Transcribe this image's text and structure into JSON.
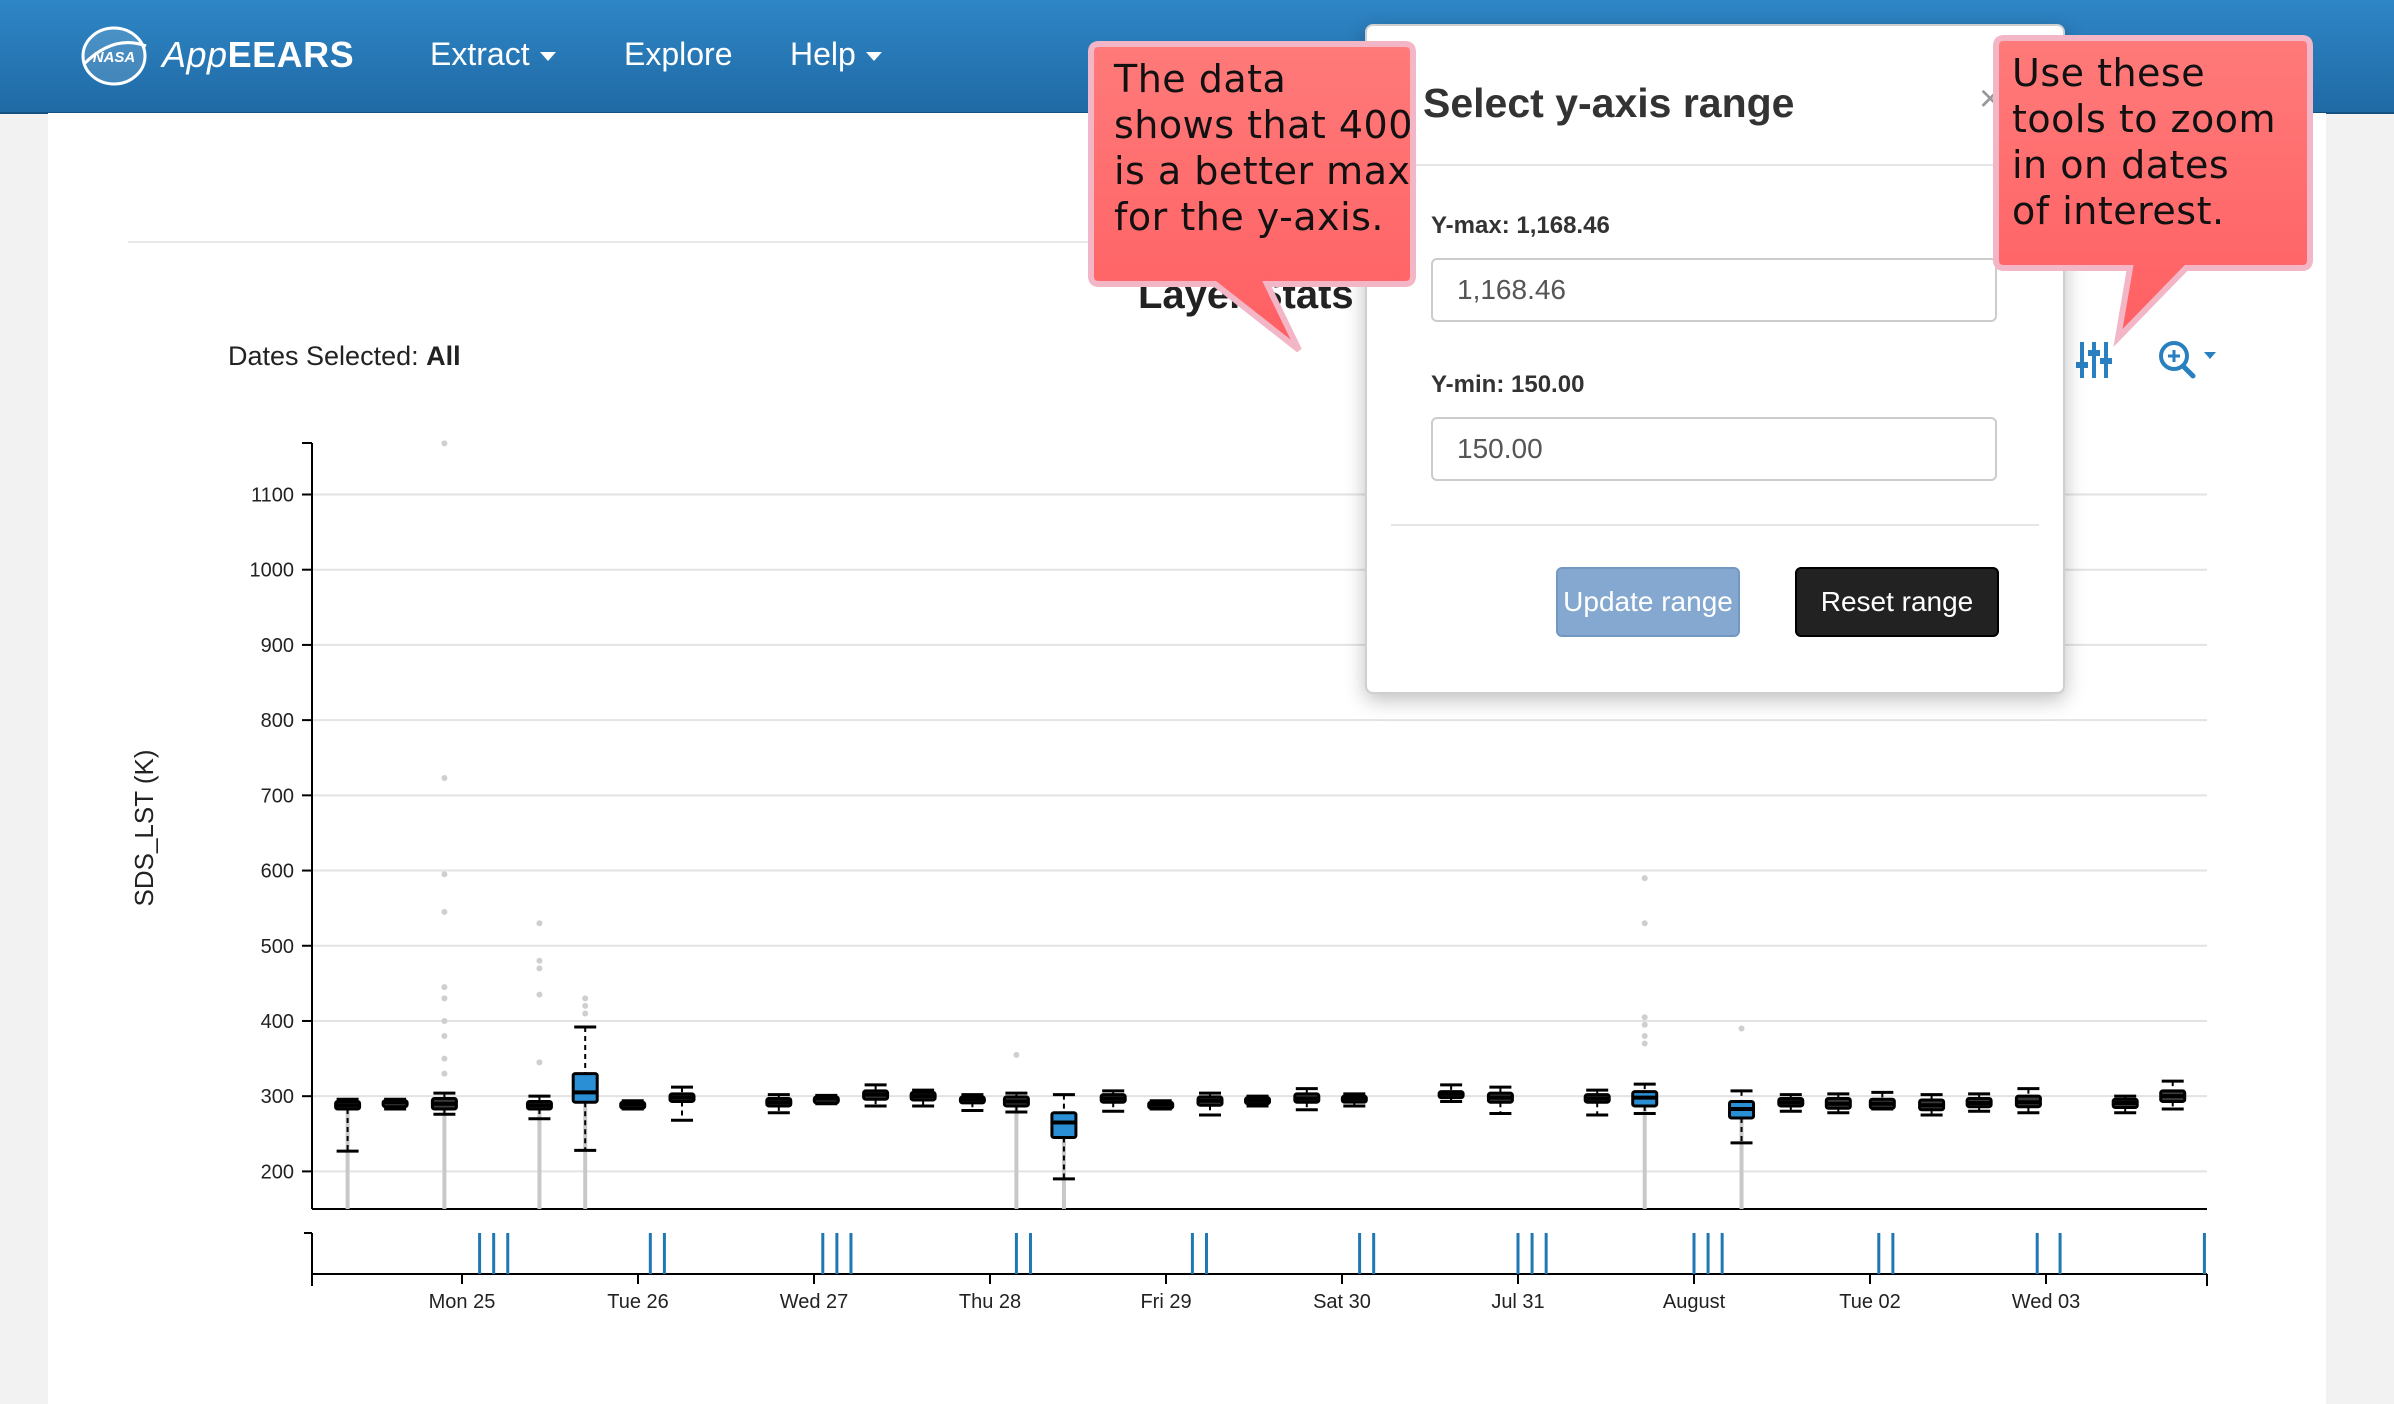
{
  "navbar": {
    "brand_app": "App",
    "brand_ears": "EEARS",
    "logo_text": "NASA",
    "items": [
      {
        "label": "Extract",
        "has_dropdown": true
      },
      {
        "label": "Explore",
        "has_dropdown": false
      },
      {
        "label": "Help",
        "has_dropdown": true
      }
    ]
  },
  "page": {
    "chart_title": "Layer Stats",
    "dates_selected_label": "Dates Selected: ",
    "dates_selected_value": "All"
  },
  "toolbar": {
    "sliders_icon": "sliders-icon",
    "zoom_icon": "zoom-in-icon"
  },
  "popover": {
    "title": "Select y-axis range",
    "close_label": "×",
    "ymax_label": "Y-max: 1,168.46",
    "ymax_value": "1,168.46",
    "ymin_label": "Y-min: 150.00",
    "ymin_value": "150.00",
    "update_button": "Update range",
    "reset_button": "Reset range"
  },
  "callouts": [
    {
      "lines": [
        "The data",
        "shows that 400",
        "is a better max",
        "for the y-axis."
      ]
    },
    {
      "lines": [
        "Use these",
        "tools to zoom",
        "in on dates",
        "of interest."
      ]
    }
  ],
  "colors": {
    "navbar": "#2a7bbd",
    "box_fill_highlight": "#2b8fd6",
    "callout_fill": "#ff6b6b",
    "brush_tick": "#1f77b4",
    "update_button": "#84a8cf",
    "reset_button": "#222222"
  },
  "chart_data": {
    "type": "box",
    "ylabel": "SDS_LST (K)",
    "xlabel": "",
    "ylim": [
      150,
      1168.46
    ],
    "yticks": [
      200,
      300,
      400,
      500,
      600,
      700,
      800,
      900,
      1000,
      1100
    ],
    "x_ticks": [
      "Mon 25",
      "Tue 26",
      "Wed 27",
      "Thu 28",
      "Fri 29",
      "Sat 30",
      "Jul 31",
      "August",
      "Tue 02",
      "Wed 03"
    ],
    "grid": true,
    "boxes": [
      {
        "day": -0.65,
        "q1": 283,
        "median": 288,
        "q3": 293,
        "lo": 227,
        "hi": 296,
        "highlight": false,
        "outliers": []
      },
      {
        "day": -0.38,
        "q1": 289,
        "median": 292,
        "q3": 294,
        "lo": 283,
        "hi": 296,
        "highlight": false,
        "outliers": []
      },
      {
        "day": -0.1,
        "q1": 283,
        "median": 290,
        "q3": 297,
        "lo": 276,
        "hi": 304,
        "highlight": false,
        "outliers": [
          330,
          350,
          380,
          400,
          430,
          445,
          545,
          595,
          723,
          1168
        ]
      },
      {
        "day": 0.44,
        "q1": 283,
        "median": 288,
        "q3": 293,
        "lo": 270,
        "hi": 300,
        "highlight": false,
        "outliers": [
          345,
          435,
          470,
          480,
          530
        ]
      },
      {
        "day": 0.7,
        "q1": 292,
        "median": 305,
        "q3": 330,
        "lo": 228,
        "hi": 392,
        "highlight": true,
        "outliers": [
          410,
          420,
          430
        ]
      },
      {
        "day": 0.97,
        "q1": 286,
        "median": 289,
        "q3": 292,
        "lo": 283,
        "hi": 294,
        "highlight": false,
        "outliers": []
      },
      {
        "day": 1.25,
        "q1": 293,
        "median": 298,
        "q3": 303,
        "lo": 268,
        "hi": 312,
        "highlight": false,
        "outliers": []
      },
      {
        "day": 1.8,
        "q1": 287,
        "median": 292,
        "q3": 297,
        "lo": 278,
        "hi": 302,
        "highlight": false,
        "outliers": []
      },
      {
        "day": 2.07,
        "q1": 294,
        "median": 297,
        "q3": 299,
        "lo": 290,
        "hi": 301,
        "highlight": false,
        "outliers": []
      },
      {
        "day": 2.35,
        "q1": 296,
        "median": 302,
        "q3": 307,
        "lo": 287,
        "hi": 315,
        "highlight": false,
        "outliers": []
      },
      {
        "day": 2.62,
        "q1": 295,
        "median": 300,
        "q3": 305,
        "lo": 287,
        "hi": 308,
        "highlight": false,
        "outliers": []
      },
      {
        "day": 2.9,
        "q1": 292,
        "median": 296,
        "q3": 299,
        "lo": 281,
        "hi": 302,
        "highlight": false,
        "outliers": []
      },
      {
        "day": 3.15,
        "q1": 287,
        "median": 293,
        "q3": 299,
        "lo": 279,
        "hi": 304,
        "highlight": false,
        "outliers": [
          355
        ]
      },
      {
        "day": 3.42,
        "q1": 245,
        "median": 265,
        "q3": 278,
        "lo": 190,
        "hi": 302,
        "highlight": true,
        "outliers": []
      },
      {
        "day": 3.7,
        "q1": 292,
        "median": 297,
        "q3": 302,
        "lo": 280,
        "hi": 307,
        "highlight": false,
        "outliers": []
      },
      {
        "day": 3.97,
        "q1": 285,
        "median": 289,
        "q3": 292,
        "lo": 283,
        "hi": 294,
        "highlight": false,
        "outliers": []
      },
      {
        "day": 4.25,
        "q1": 288,
        "median": 294,
        "q3": 299,
        "lo": 275,
        "hi": 304,
        "highlight": false,
        "outliers": []
      },
      {
        "day": 4.52,
        "q1": 292,
        "median": 295,
        "q3": 298,
        "lo": 287,
        "hi": 300,
        "highlight": false,
        "outliers": []
      },
      {
        "day": 4.8,
        "q1": 292,
        "median": 297,
        "q3": 303,
        "lo": 282,
        "hi": 310,
        "highlight": false,
        "outliers": []
      },
      {
        "day": 5.07,
        "q1": 294,
        "median": 297,
        "q3": 300,
        "lo": 287,
        "hi": 303,
        "highlight": false,
        "outliers": []
      },
      {
        "day": 5.62,
        "q1": 300,
        "median": 303,
        "q3": 306,
        "lo": 293,
        "hi": 315,
        "highlight": false,
        "outliers": []
      },
      {
        "day": 5.9,
        "q1": 292,
        "median": 298,
        "q3": 304,
        "lo": 277,
        "hi": 312,
        "highlight": false,
        "outliers": []
      },
      {
        "day": 6.45,
        "q1": 292,
        "median": 297,
        "q3": 302,
        "lo": 275,
        "hi": 308,
        "highlight": false,
        "outliers": []
      },
      {
        "day": 6.72,
        "q1": 287,
        "median": 298,
        "q3": 306,
        "lo": 277,
        "hi": 316,
        "highlight": true,
        "outliers": [
          370,
          380,
          395,
          405,
          530,
          590
        ]
      },
      {
        "day": 7.27,
        "q1": 271,
        "median": 283,
        "q3": 293,
        "lo": 238,
        "hi": 307,
        "highlight": true,
        "outliers": [
          390
        ]
      },
      {
        "day": 7.55,
        "q1": 287,
        "median": 292,
        "q3": 297,
        "lo": 280,
        "hi": 302,
        "highlight": false,
        "outliers": []
      },
      {
        "day": 7.82,
        "q1": 284,
        "median": 290,
        "q3": 297,
        "lo": 278,
        "hi": 303,
        "highlight": false,
        "outliers": []
      },
      {
        "day": 8.07,
        "q1": 284,
        "median": 290,
        "q3": 296,
        "lo": 283,
        "hi": 305,
        "highlight": false,
        "outliers": []
      },
      {
        "day": 8.35,
        "q1": 282,
        "median": 288,
        "q3": 295,
        "lo": 275,
        "hi": 302,
        "highlight": false,
        "outliers": []
      },
      {
        "day": 8.62,
        "q1": 286,
        "median": 291,
        "q3": 297,
        "lo": 280,
        "hi": 303,
        "highlight": false,
        "outliers": []
      },
      {
        "day": 8.9,
        "q1": 286,
        "median": 292,
        "q3": 300,
        "lo": 278,
        "hi": 310,
        "highlight": false,
        "outliers": []
      },
      {
        "day": 9.45,
        "q1": 285,
        "median": 291,
        "q3": 296,
        "lo": 278,
        "hi": 300,
        "highlight": false,
        "outliers": []
      },
      {
        "day": 9.72,
        "q1": 293,
        "median": 300,
        "q3": 307,
        "lo": 283,
        "hi": 320,
        "highlight": false,
        "outliers": []
      }
    ],
    "brush_days": [
      0.1,
      0.18,
      0.26,
      1.07,
      1.15,
      2.05,
      2.13,
      2.21,
      3.15,
      3.23,
      4.15,
      4.23,
      5.1,
      5.18,
      6.0,
      6.08,
      6.16,
      7.0,
      7.08,
      7.16,
      8.05,
      8.13,
      8.95,
      9.08,
      9.9
    ]
  }
}
